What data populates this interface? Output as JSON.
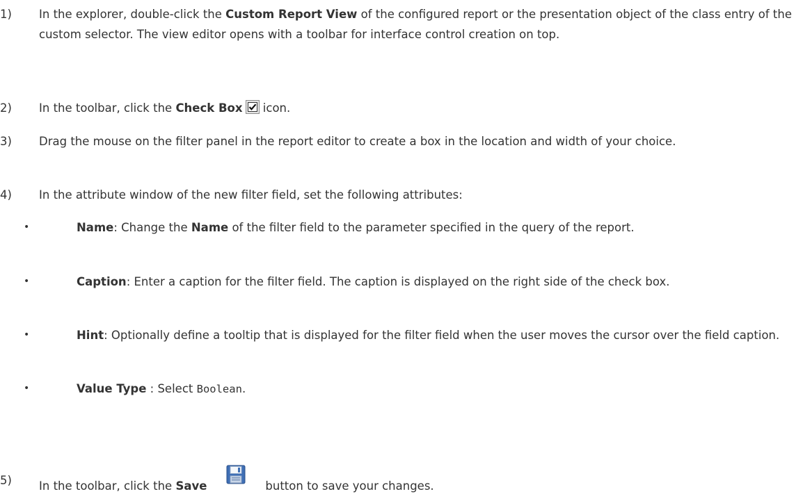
{
  "steps": [
    {
      "num": "1)",
      "t1": "In the explorer, double-click the ",
      "b1": "Custom Report View",
      "t2": " of the configured report or the presentation object of the class entry of the custom selector. The view editor opens with a toolbar for interface control creation on top."
    },
    {
      "num": "2)",
      "t1": "In the toolbar, click the ",
      "b1": "Check Box",
      "icon": "checkbox-icon",
      "t2": " icon."
    },
    {
      "num": "3)",
      "t1": "Drag the mouse on the filter panel in the report editor to create a box in the location and width of your choice."
    },
    {
      "num": "4)",
      "t1": "In the attribute window of the new filter field, set the following attributes:"
    },
    {
      "num": "5)",
      "t1": "In the toolbar, click the ",
      "b1": "Save",
      "icon": "save-icon",
      "t2": "button to save your changes."
    }
  ],
  "bullets": [
    {
      "dot": "•",
      "b1": "Name",
      "t1": ": Change the ",
      "b2": "Name",
      "t2": " of the filter field to the parameter specified in the query of the report."
    },
    {
      "dot": "•",
      "b1": "Caption",
      "t1": ": Enter a caption for the filter field. The caption is displayed on the right side of the check box."
    },
    {
      "dot": "•",
      "b1": "Hint",
      "t1": ": Optionally define a tooltip that is displayed for the filter field when the user moves the cursor over the field caption."
    },
    {
      "dot": "•",
      "b1": "Value Type",
      "t1": " : Select ",
      "code": "Boolean",
      "t2": "."
    }
  ]
}
